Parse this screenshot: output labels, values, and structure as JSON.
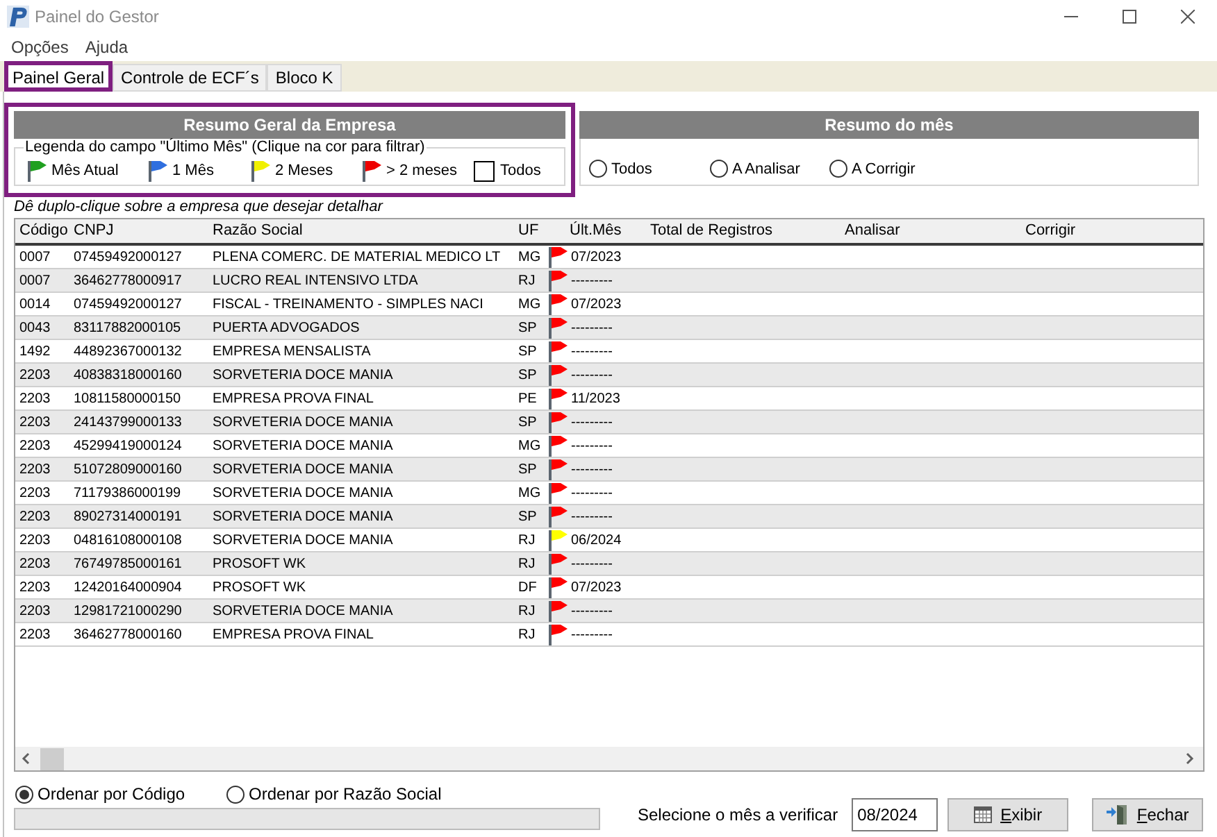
{
  "window": {
    "title": "Painel do Gestor"
  },
  "menu": [
    {
      "label": "Opções"
    },
    {
      "label": "Ajuda"
    }
  ],
  "tabs": [
    {
      "label": "Painel Geral",
      "selected": true,
      "highlighted": true
    },
    {
      "label": "Controle de ECF´s",
      "selected": false,
      "highlighted": false
    },
    {
      "label": "Bloco K",
      "selected": false,
      "highlighted": false
    }
  ],
  "company_summary": {
    "title": "Resumo Geral da Empresa",
    "highlighted": true,
    "legend_title": "Legenda do campo \"Último Mês\" (Clique na cor para filtrar)",
    "legend": [
      {
        "label": "Mês Atual",
        "color": "#20a020"
      },
      {
        "label": "1 Mês",
        "color": "#2f6fdf"
      },
      {
        "label": "2 Meses",
        "color": "#f0f000"
      },
      {
        "label": "> 2 meses",
        "color": "#ee0000"
      }
    ],
    "all": {
      "label": "Todos",
      "checked": false
    }
  },
  "month_summary": {
    "title": "Resumo do mês",
    "options": [
      {
        "label": "Todos",
        "selected": false
      },
      {
        "label": "A Analisar",
        "selected": false
      },
      {
        "label": "A Corrigir",
        "selected": false
      }
    ]
  },
  "hint": "Dê duplo-clique sobre a empresa que desejar detalhar",
  "table": {
    "columns": [
      "Código",
      "CNPJ",
      "Razão Social",
      "UF",
      "Últ.Mês",
      "Total de Registros",
      "Analisar",
      "Corrigir"
    ],
    "rows": [
      {
        "code": "0007",
        "cnpj": "07459492000127",
        "company": "PLENA COMERC. DE MATERIAL MEDICO LT",
        "uf": "MG",
        "flag": {
          "color": "#ff0000"
        },
        "last_month": "07/2023"
      },
      {
        "code": "0007",
        "cnpj": "36462778000917",
        "company": "LUCRO REAL INTENSIVO LTDA",
        "uf": "RJ",
        "flag": {
          "color": "#ff0000"
        },
        "last_month": "---------"
      },
      {
        "code": "0014",
        "cnpj": "07459492000127",
        "company": "FISCAL - TREINAMENTO - SIMPLES NACI",
        "uf": "MG",
        "flag": {
          "color": "#ff0000"
        },
        "last_month": "07/2023"
      },
      {
        "code": "0043",
        "cnpj": "83117882000105",
        "company": "PUERTA ADVOGADOS",
        "uf": "SP",
        "flag": {
          "color": "#ff0000"
        },
        "last_month": "---------"
      },
      {
        "code": "1492",
        "cnpj": "44892367000132",
        "company": "EMPRESA MENSALISTA",
        "uf": "SP",
        "flag": {
          "color": "#ff0000"
        },
        "last_month": "---------"
      },
      {
        "code": "2203",
        "cnpj": "40838318000160",
        "company": "SORVETERIA DOCE MANIA",
        "uf": "SP",
        "flag": {
          "color": "#ff0000"
        },
        "last_month": "---------"
      },
      {
        "code": "2203",
        "cnpj": "10811580000150",
        "company": "EMPRESA PROVA FINAL",
        "uf": "PE",
        "flag": {
          "color": "#ff0000"
        },
        "last_month": "11/2023"
      },
      {
        "code": "2203",
        "cnpj": "24143799000133",
        "company": "SORVETERIA DOCE MANIA",
        "uf": "SP",
        "flag": {
          "color": "#ff0000"
        },
        "last_month": "---------"
      },
      {
        "code": "2203",
        "cnpj": "45299419000124",
        "company": "SORVETERIA DOCE MANIA",
        "uf": "MG",
        "flag": {
          "color": "#ff0000"
        },
        "last_month": "---------"
      },
      {
        "code": "2203",
        "cnpj": "51072809000160",
        "company": "SORVETERIA DOCE MANIA",
        "uf": "SP",
        "flag": {
          "color": "#ff0000"
        },
        "last_month": "---------"
      },
      {
        "code": "2203",
        "cnpj": "71179386000199",
        "company": "SORVETERIA DOCE MANIA",
        "uf": "MG",
        "flag": {
          "color": "#ff0000"
        },
        "last_month": "---------"
      },
      {
        "code": "2203",
        "cnpj": "89027314000191",
        "company": "SORVETERIA DOCE MANIA",
        "uf": "SP",
        "flag": {
          "color": "#ff0000"
        },
        "last_month": "---------"
      },
      {
        "code": "2203",
        "cnpj": "04816108000108",
        "company": "SORVETERIA DOCE MANIA",
        "uf": "RJ",
        "flag": {
          "color": "#ffff00"
        },
        "last_month": "06/2024"
      },
      {
        "code": "2203",
        "cnpj": "76749785000161",
        "company": "PROSOFT WK",
        "uf": "RJ",
        "flag": {
          "color": "#ff0000"
        },
        "last_month": "---------"
      },
      {
        "code": "2203",
        "cnpj": "12420164000904",
        "company": "PROSOFT WK",
        "uf": "DF",
        "flag": {
          "color": "#ff0000"
        },
        "last_month": "07/2023"
      },
      {
        "code": "2203",
        "cnpj": "12981721000290",
        "company": "SORVETERIA DOCE MANIA",
        "uf": "RJ",
        "flag": {
          "color": "#ff0000"
        },
        "last_month": "---------"
      },
      {
        "code": "2203",
        "cnpj": "36462778000160",
        "company": "EMPRESA PROVA FINAL",
        "uf": "RJ",
        "flag": {
          "color": "#ff0000"
        },
        "last_month": "---------"
      }
    ]
  },
  "sort": [
    {
      "label": "Ordenar por Código",
      "selected": true
    },
    {
      "label": "Ordenar por Razão Social",
      "selected": false
    }
  ],
  "month_filter": {
    "label": "Selecione o mês a verificar",
    "value": "08/2024"
  },
  "buttons": [
    {
      "label": "Exibir",
      "kind": "show"
    },
    {
      "label": "Fechar",
      "kind": "close"
    }
  ]
}
